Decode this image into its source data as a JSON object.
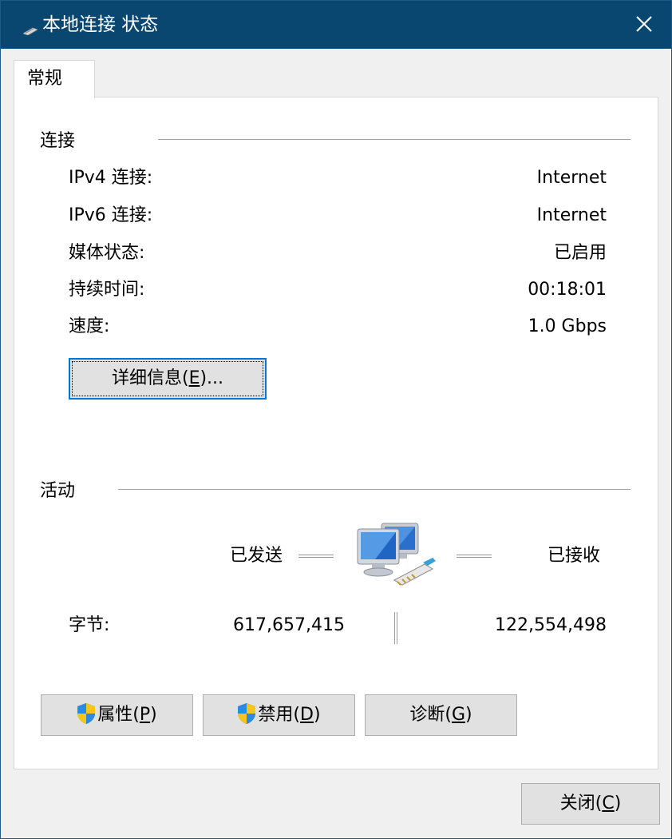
{
  "window": {
    "title": "本地连接 状态",
    "icon": "network-adapter-icon",
    "close_icon": "close-icon"
  },
  "tabs": [
    {
      "label": "常规",
      "selected": true
    }
  ],
  "connection": {
    "title": "连接",
    "rows": [
      {
        "label": "IPv4 连接:",
        "value": "Internet"
      },
      {
        "label": "IPv6 连接:",
        "value": "Internet"
      },
      {
        "label": "媒体状态:",
        "value": "已启用"
      },
      {
        "label": "持续时间:",
        "value": "00:18:01"
      },
      {
        "label": "速度:",
        "value": "1.0 Gbps"
      }
    ],
    "details_button": {
      "prefix": "详细信息(",
      "accel": "E",
      "suffix": ")..."
    }
  },
  "activity": {
    "title": "活动",
    "sent_label": "已发送",
    "received_label": "已接收",
    "icon": "network-computers-icon",
    "bytes_label": "字节:",
    "bytes_sent": "617,657,415",
    "bytes_received": "122,554,498"
  },
  "buttons": {
    "properties": {
      "prefix": "属性(",
      "accel": "P",
      "suffix": ")",
      "icon": "uac-shield-icon"
    },
    "disable": {
      "prefix": "禁用(",
      "accel": "D",
      "suffix": ")",
      "icon": "uac-shield-icon"
    },
    "diagnose": {
      "prefix": "诊断(",
      "accel": "G",
      "suffix": ")"
    },
    "close": {
      "prefix": "关闭(",
      "accel": "C",
      "suffix": ")"
    }
  },
  "colors": {
    "titlebar": "#094771",
    "window_bg": "#f0f0f0",
    "panel_bg": "#ffffff",
    "button_bg": "#e1e1e1",
    "focus_border": "#0078d7"
  }
}
